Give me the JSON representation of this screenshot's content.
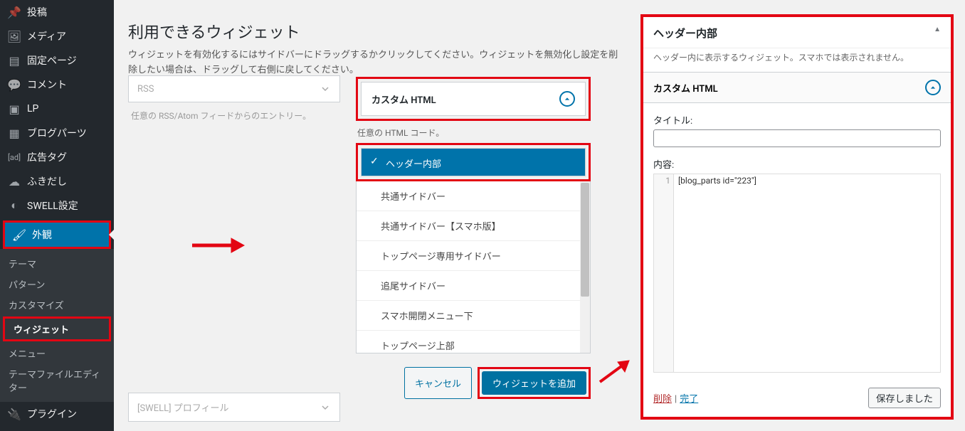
{
  "sidebar": {
    "items": [
      {
        "icon": "pin",
        "label": "投稿"
      },
      {
        "icon": "media",
        "label": "メディア"
      },
      {
        "icon": "page",
        "label": "固定ページ"
      },
      {
        "icon": "comment",
        "label": "コメント"
      },
      {
        "icon": "lp",
        "label": "LP"
      },
      {
        "icon": "parts",
        "label": "ブログパーツ"
      },
      {
        "icon": "ad",
        "label": "広告タグ"
      },
      {
        "icon": "balloon",
        "label": "ふきだし"
      },
      {
        "icon": "swell",
        "label": "SWELL設定"
      }
    ],
    "active": {
      "icon": "brush",
      "label": "外観"
    },
    "sub": [
      "テーマ",
      "パターン",
      "カスタマイズ",
      "ウィジェット",
      "メニュー",
      "テーマファイルエディター"
    ],
    "sub_current_index": 3,
    "tail": {
      "icon": "plugin",
      "label": "プラグイン"
    }
  },
  "page": {
    "title": "利用できるウィジェット",
    "desc": "ウィジェットを有効化するにはサイドバーにドラッグするかクリックしてください。ウィジェットを無効化し設定を削除したい場合は、ドラッグして右側に戻してください。"
  },
  "left_widget": {
    "name": "RSS",
    "desc": "任意の RSS/Atom フィードからのエントリー。"
  },
  "left_widget2": {
    "name": "[SWELL] プロフィール"
  },
  "dropdown": {
    "header": "カスタム HTML",
    "note": "任意の HTML コード。",
    "options": [
      "ヘッダー内部",
      "共通サイドバー",
      "共通サイドバー【スマホ版】",
      "トップページ専用サイドバー",
      "追尾サイドバー",
      "スマホ開閉メニュー下",
      "トップページ上部"
    ],
    "selected_index": 0
  },
  "buttons": {
    "cancel": "キャンセル",
    "add": "ウィジェットを追加"
  },
  "panel": {
    "title": "ヘッダー内部",
    "desc": "ヘッダー内に表示するウィジェット。スマホでは表示されません。",
    "widget": "カスタム HTML",
    "title_label": "タイトル:",
    "title_value": "",
    "content_label": "内容:",
    "line_no": "1",
    "code": "[blog_parts id=\"223\"]",
    "delete": "削除",
    "done": "完了",
    "saved": "保存しました"
  }
}
